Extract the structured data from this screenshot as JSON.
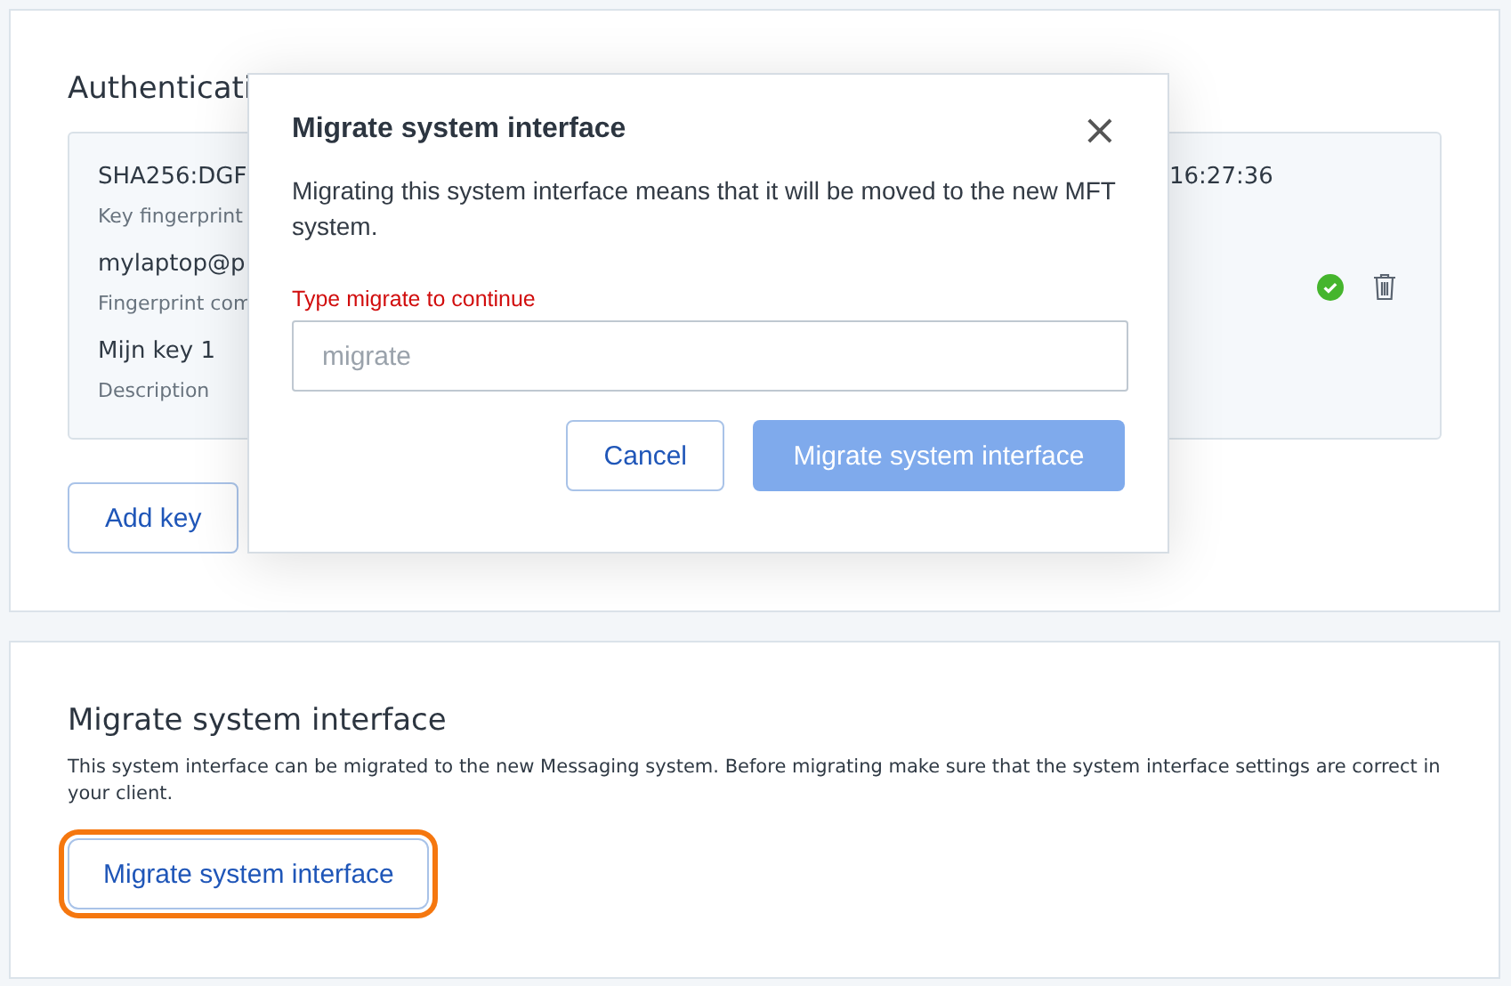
{
  "auth_section": {
    "heading": "Authenticati",
    "key": {
      "fingerprint": "SHA256:DGF",
      "fingerprint_label": "Key fingerprint",
      "comment": "mylaptop@p",
      "comment_label": "Fingerprint com",
      "description": "Mijn key 1",
      "description_label": "Description",
      "time": "16:27:36",
      "verified": true
    },
    "add_button": "Add key"
  },
  "migrate_section": {
    "heading": "Migrate system interface",
    "text": "This system interface can be migrated to the new Messaging system. Before migrating make sure that the system interface settings are correct in your client.",
    "button": {
      "label": "Migrate system interface",
      "highlighted": true
    }
  },
  "dialog": {
    "title": "Migrate system interface",
    "close": "×",
    "text": "Migrating this system interface means that it will be moved to the new MFT system.",
    "field_label": "Type migrate to continue",
    "placeholder": "migrate",
    "buttons": [
      {
        "label": "Cancel",
        "kind": "secondary",
        "disabled": false
      },
      {
        "label": "Migrate system interface",
        "kind": "primary",
        "disabled": true
      }
    ]
  }
}
